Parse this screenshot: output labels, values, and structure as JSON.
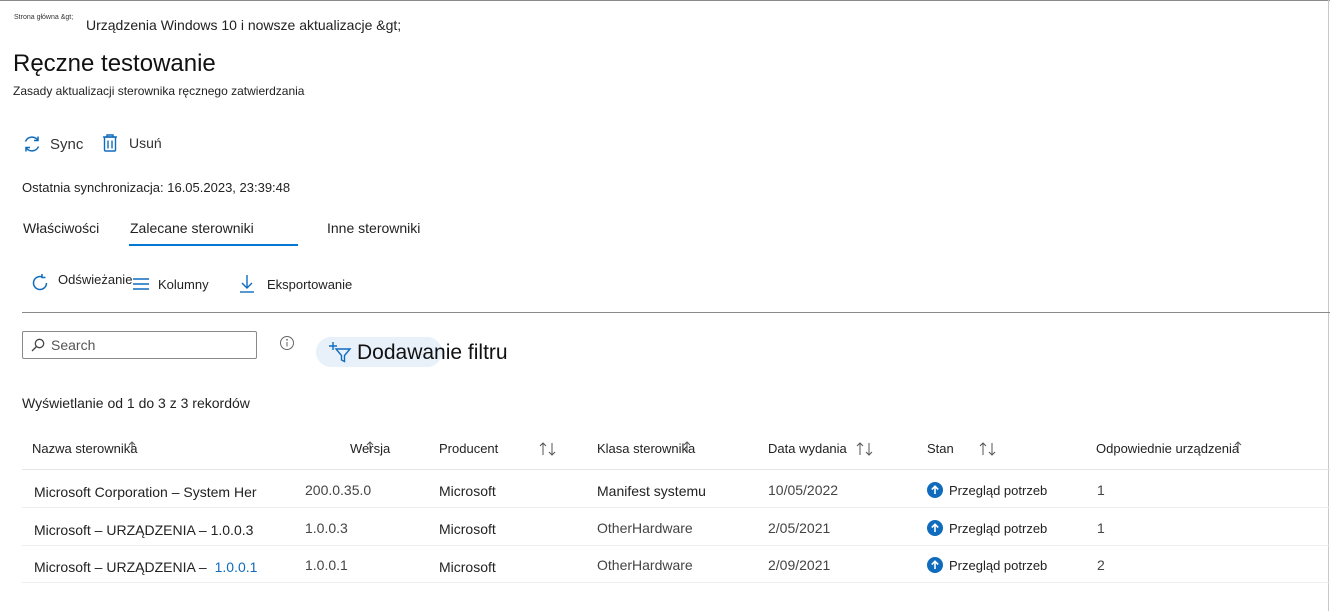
{
  "breadcrumb": {
    "home": "Strona główna &gt;",
    "parent": "Urządzenia Windows 10 i nowsze aktualizacje &gt;"
  },
  "page": {
    "title": "Ręczne testowanie",
    "subtitle": "Zasady aktualizacji sterownika ręcznego zatwierdzania"
  },
  "toolbar": {
    "sync_label": "Sync",
    "delete_label": "Usuń"
  },
  "last_sync": "Ostatnia synchronizacja: 16.05.2023, 23:39:48",
  "tabs": [
    {
      "label": "Właściwości"
    },
    {
      "label": "Zalecane sterowniki",
      "selected": true
    },
    {
      "label": "Inne sterowniki"
    }
  ],
  "actions": {
    "refresh_label": "Odświeżanie",
    "columns_label": "Kolumny",
    "export_label": "Eksportowanie"
  },
  "search": {
    "placeholder": "Search"
  },
  "filter": {
    "label": "Dodawanie filtru"
  },
  "records_text": "Wyświetlanie od 1 do 3 z 3 rekordów",
  "table": {
    "columns": [
      "Nazwa sterownika",
      "Wersja",
      "Producent",
      "Klasa sterownika",
      "Data wydania",
      "Stan",
      "Odpowiednie urządzenia"
    ],
    "rows": [
      {
        "name": "Microsoft Corporation – System Her",
        "name_link": "",
        "version": "200.0.35.0",
        "manufacturer": "Microsoft",
        "class": "Manifest systemu",
        "date": "10/05/2022",
        "status": "Przegląd potrzeb",
        "devices": "1"
      },
      {
        "name": "Microsoft – URZĄDZENIA – 1.0.0.3",
        "name_link": "",
        "version": "1.0.0.3",
        "manufacturer": "Microsoft",
        "class": "OtherHardware",
        "date": "2/05/2021",
        "status": "Przegląd potrzeb",
        "devices": "1"
      },
      {
        "name": "Microsoft – URZĄDZENIA –",
        "name_link": "1.0.0.1",
        "version": "1.0.0.1",
        "manufacturer": "Microsoft",
        "class": "OtherHardware",
        "date": "2/09/2021",
        "status": "Przegląd potrzeb",
        "devices": "2"
      }
    ]
  },
  "colors": {
    "accent": "#0078d4",
    "link": "#0f6cbd",
    "status_icon": "#0f6cbd",
    "filter_bg": "#e8f0fa"
  },
  "icons": {
    "sync": "sync-icon",
    "delete": "trash-icon",
    "refresh": "refresh-icon",
    "columns": "columns-icon",
    "export": "download-icon",
    "search": "search-icon",
    "info": "info-icon",
    "filter": "add-filter-icon",
    "sort": "sort-arrows-icon",
    "status": "arrow-up-circle-icon"
  }
}
